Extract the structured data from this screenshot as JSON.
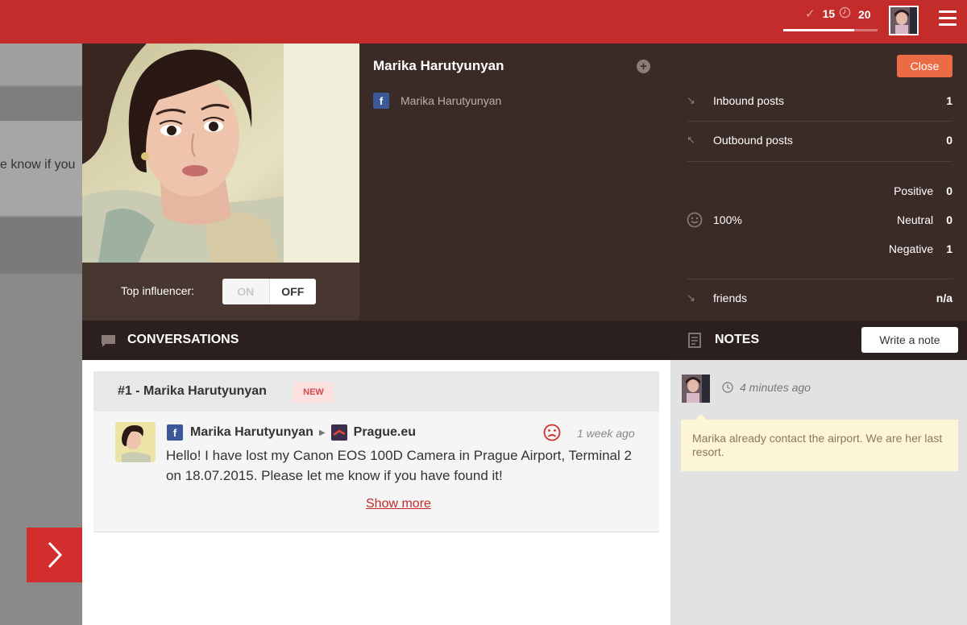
{
  "topbar": {
    "resolved_count": "15",
    "pending_count": "20",
    "progress_fraction": 0.75,
    "accent": "#c42b2b"
  },
  "background_page": {
    "text_fragment": "e know if you"
  },
  "profile": {
    "name": "Marika Harutyunyan",
    "facebook_name": "Marika Harutyunyan",
    "top_influencer_label": "Top influencer:",
    "toggle_on": "ON",
    "toggle_off": "OFF"
  },
  "stats": {
    "close_label": "Close",
    "inbound_label": "Inbound posts",
    "inbound_value": "1",
    "outbound_label": "Outbound posts",
    "outbound_value": "0",
    "sentiment_percent": "100%",
    "positive_label": "Positive",
    "positive_value": "0",
    "neutral_label": "Neutral",
    "neutral_value": "0",
    "negative_label": "Negative",
    "negative_value": "1",
    "friends_label": "friends",
    "friends_value": "n/a"
  },
  "conversations": {
    "title": "CONVERSATIONS",
    "items": [
      {
        "title": "#1 - Marika Harutyunyan",
        "badge": "NEW",
        "author": "Marika Harutyunyan",
        "page": "Prague.eu",
        "time": "1 week ago",
        "text": "Hello! I have lost my Canon EOS 100D Camera in Prague Airport, Terminal 2 on 18.07.2015. Please let me know if you have found it!",
        "show_more": "Show more"
      }
    ]
  },
  "notes": {
    "title": "NOTES",
    "write_label": "Write a note",
    "items": [
      {
        "time": "4 minutes ago",
        "text": "Marika already contact the airport. We are her last resort."
      }
    ]
  }
}
